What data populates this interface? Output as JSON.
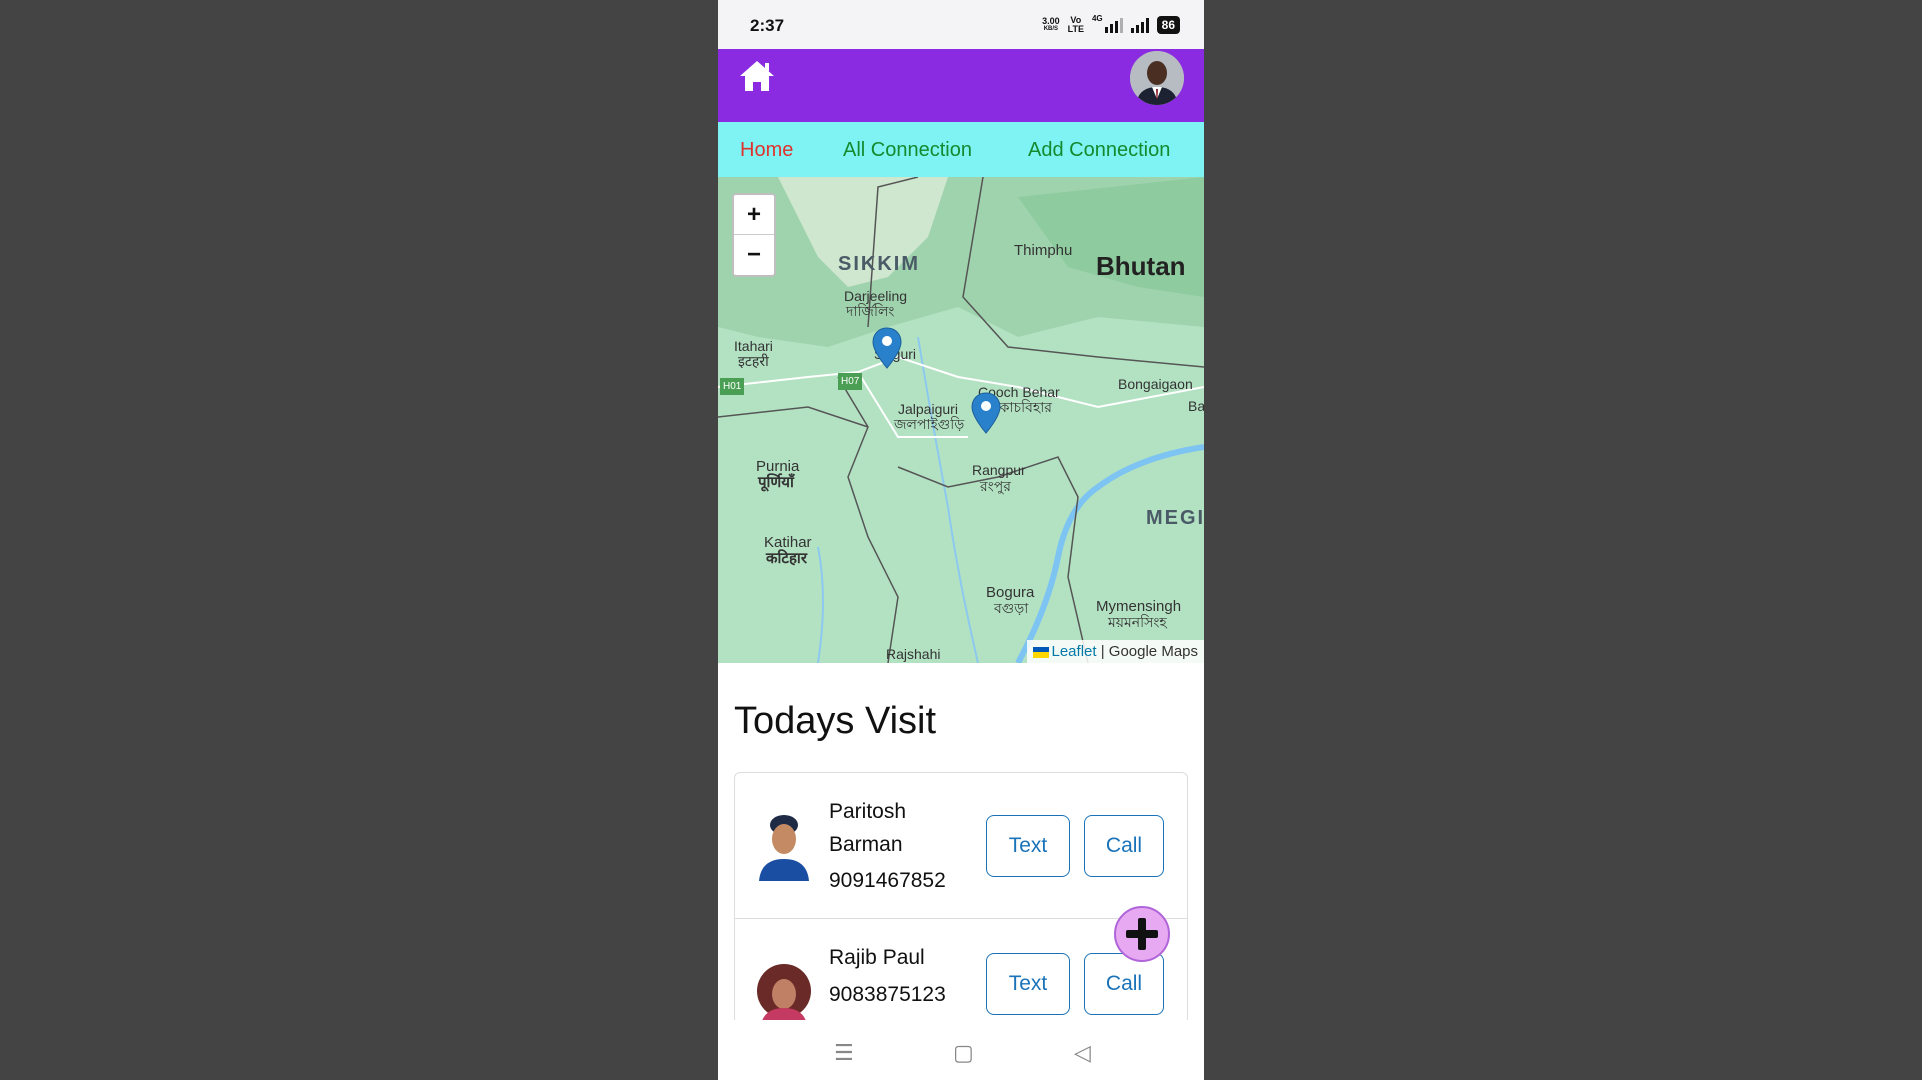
{
  "status_bar": {
    "time": "2:37",
    "net_speed": "3.00",
    "net_speed_unit": "KB/S",
    "volte_top": "Vo",
    "volte_bottom": "LTE",
    "network_type": "4G",
    "battery": "86"
  },
  "app_bar": {
    "home_icon": "home-icon",
    "avatar": "user-avatar",
    "color": "#8a2be2"
  },
  "nav": {
    "home": "Home",
    "all_connection": "All Connection",
    "add_connection": "Add Connection",
    "active_color": "#e0322d",
    "link_color": "#138a2e",
    "background": "#7ff3f3"
  },
  "map": {
    "zoom_in": "+",
    "zoom_out": "−",
    "labels": {
      "sikkim": "SIKKIM",
      "thimphu": "Thimphu",
      "bhutan": "Bhutan",
      "darjeeling": "Darjeeling",
      "darjeeling_local": "দার্জিলিং",
      "itahari": "Itahari",
      "itahari_local": "इटहरी",
      "siliguri": "Siliguri",
      "h01": "H01",
      "h07": "H07",
      "jalpaiguri": "Jalpaiguri",
      "jalpaiguri_local": "জলপাইগুড়ি",
      "cooch_behar": "Cooch Behar",
      "cooch_behar_local": "কোচবিহার",
      "bongaigaon": "Bongaigaon",
      "ba": "Ba",
      "purnia": "Purnia",
      "purnia_local": "पूर्णियाँ",
      "rangpur": "Rangpur",
      "rangpur_local": "রংপুর",
      "megh": "MEGI",
      "katihar": "Katihar",
      "katihar_local": "कटिहार",
      "bogura": "Bogura",
      "bogura_local": "বগুড়া",
      "mymensingh": "Mymensingh",
      "mymensingh_local": "ময়মনসিংহ",
      "rajshahi": "Rajshahi"
    },
    "attribution_leaflet": "Leaflet",
    "attribution_sep": " | ",
    "attribution_provider": "Google Maps"
  },
  "visits": {
    "title": "Todays Visit",
    "items": [
      {
        "name": "Paritosh Barman",
        "phone": "9091467852",
        "text_label": "Text",
        "call_label": "Call"
      },
      {
        "name": "Rajib Paul",
        "phone": "9083875123",
        "text_label": "Text",
        "call_label": "Call"
      }
    ]
  },
  "fab": {
    "icon": "plus-icon"
  },
  "system_nav": {
    "menu": "☰",
    "home": "▢",
    "back": "◁"
  }
}
